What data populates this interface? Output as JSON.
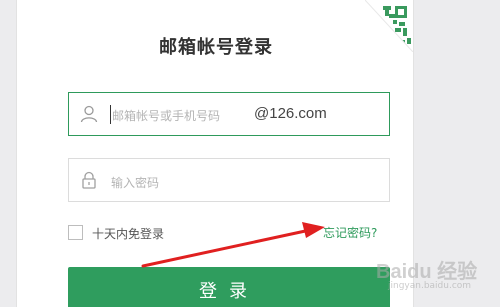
{
  "login": {
    "title": "邮箱帐号登录",
    "username_placeholder": "邮箱帐号或手机号码",
    "domain_suffix": "@126.com",
    "password_placeholder": "输入密码",
    "remember_label": "十天内免登录",
    "remember_checked": false,
    "forgot_link": "忘记密码?",
    "submit_label": "登录"
  },
  "theme": {
    "accent": "#2e9a5b",
    "arrow_color": "#e02020"
  },
  "icons": {
    "qr_corner": "qr-code-icon",
    "user": "user-icon",
    "lock": "lock-icon"
  },
  "watermark": {
    "text": "Baidu 经验",
    "sub": "jingyan.baidu.com"
  }
}
